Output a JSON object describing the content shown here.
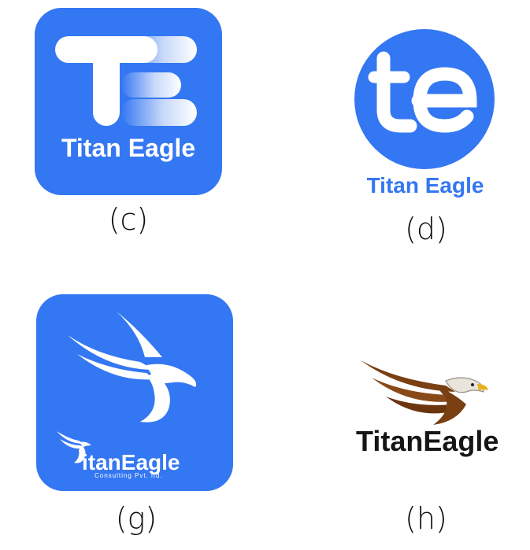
{
  "colors": {
    "brand_blue": "#3477f2",
    "eagle_brown": "#7a3f12",
    "ink": "#161616"
  },
  "logos": {
    "c": {
      "caption": "(c)",
      "wordmark": "Titan Eagle",
      "icon": "te-monogram-square-icon"
    },
    "d": {
      "caption": "(d)",
      "wordmark": "Titan Eagle",
      "icon": "te-monogram-circle-icon"
    },
    "g": {
      "caption": "(g)",
      "wordmark": "itanEagle",
      "tagline": "Consulting Pvt. ltd.",
      "icon": "eagle-t-square-icon"
    },
    "h": {
      "caption": "(h)",
      "wordmark": "TitanEagle",
      "icon": "brown-eagle-icon"
    }
  }
}
